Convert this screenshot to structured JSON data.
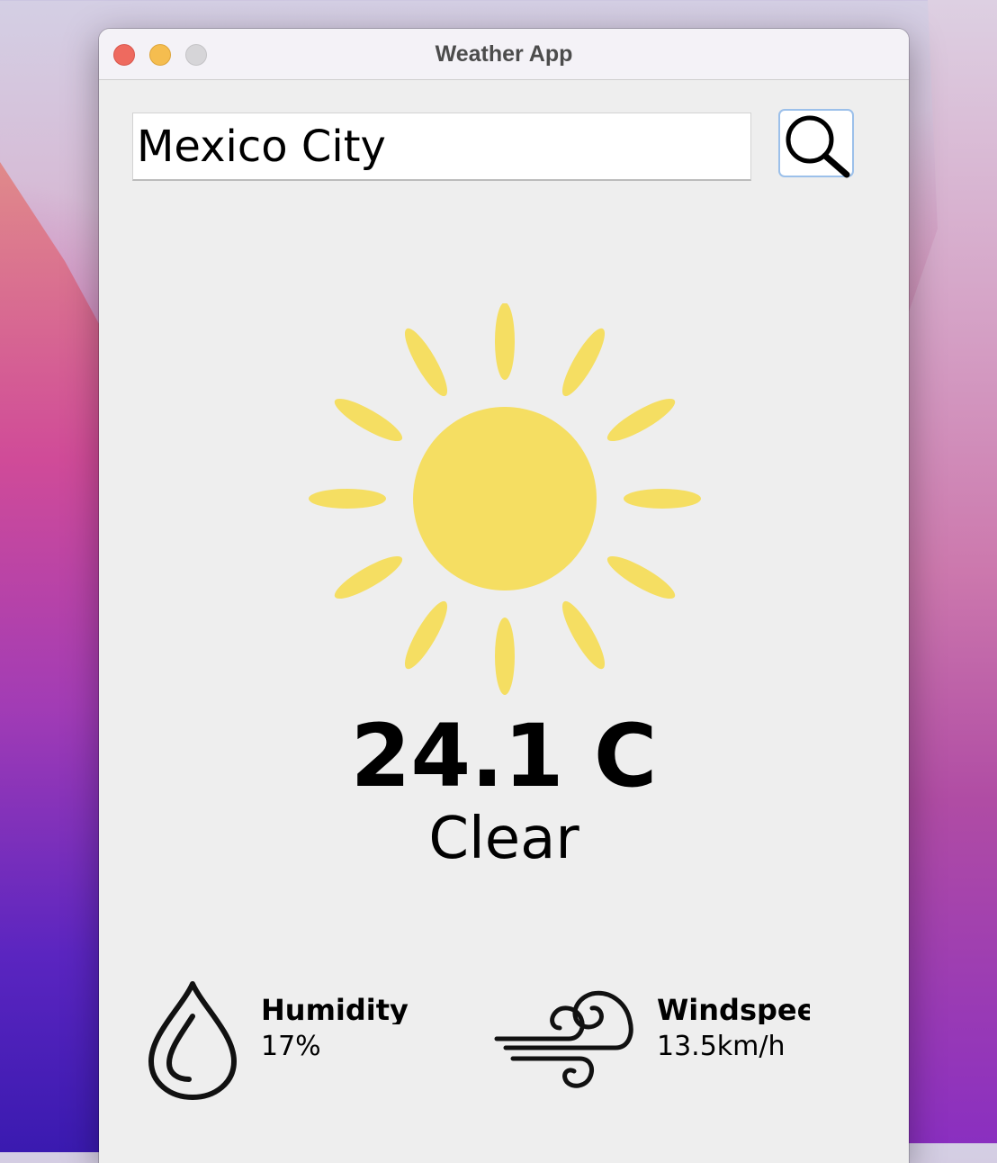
{
  "window": {
    "title": "Weather App"
  },
  "search": {
    "value": "Mexico City",
    "button_icon": "search-icon"
  },
  "weather": {
    "icon": "sun-icon",
    "icon_color": "#f5de62",
    "temperature": "24.1 C",
    "condition": "Clear"
  },
  "stats": {
    "humidity": {
      "label": "Humidity",
      "value": "17%",
      "icon": "humidity-icon"
    },
    "windspeed": {
      "label": "Windspeed",
      "value": "13.5km/h",
      "icon": "wind-icon"
    }
  }
}
